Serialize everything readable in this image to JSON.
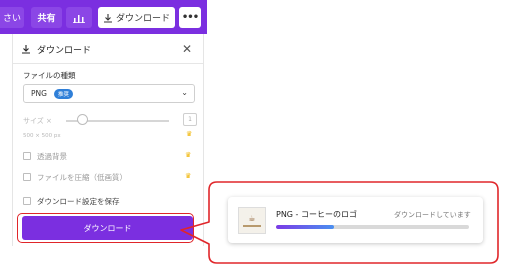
{
  "toolbar": {
    "partial_label": "さい",
    "share_label": "共有",
    "download_label": "ダウンロード",
    "more_label": "•••"
  },
  "panel": {
    "title": "ダウンロード",
    "file_type_label": "ファイルの種類",
    "file_type_value": "PNG",
    "file_type_badge": "推奨",
    "size_label": "サイズ ×",
    "size_value": "1",
    "dimensions": "500 × 500 px",
    "transparent_bg_label": "透過背景",
    "compress_label": "ファイルを圧縮（低画質）",
    "save_settings_label": "ダウンロード設定を保存",
    "download_button_label": "ダウンロード"
  },
  "notification": {
    "title": "PNG - コーヒーのロゴ",
    "status": "ダウンロードしています",
    "progress": 0.3
  },
  "colors": {
    "brand": "#7b2fe0",
    "highlight": "#e0262a",
    "premium": "#f0b400"
  }
}
